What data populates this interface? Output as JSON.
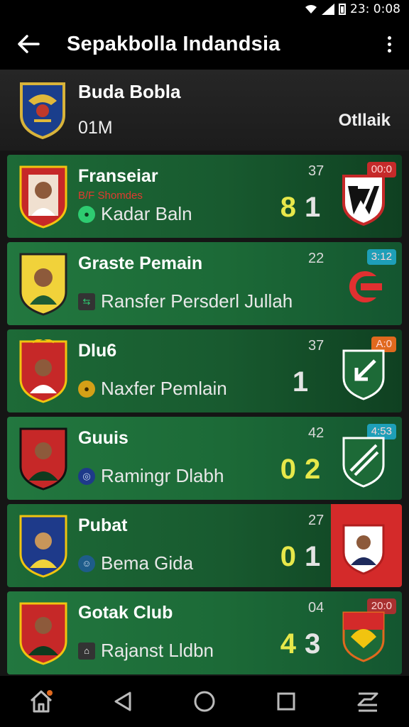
{
  "status": {
    "time": "23: 0:08"
  },
  "appbar": {
    "title": "Sepakbolla Indandsia"
  },
  "header": {
    "club_name": "Buda Bobla",
    "subtitle": "01M",
    "right_label": "Otllaik"
  },
  "matches": [
    {
      "title": "Franseiar",
      "tag": "B/F Shomdes",
      "line": "Kadar Baln",
      "minute": "37",
      "score_home": "8",
      "score_away": "1",
      "badge": "00:0",
      "badge_color": "#c62a2a",
      "icon_color": "#2ecc71"
    },
    {
      "title": "Graste Pemain",
      "tag": "",
      "line": "Ransfer Persderl Jullah",
      "minute": "22",
      "score_home": "",
      "score_away": "",
      "badge": "3:12",
      "badge_color": "#1e9fb8",
      "icon_color": "#7a2a8a"
    },
    {
      "title": "Dlu6",
      "tag": "",
      "line": "Naxfer Pemlain",
      "minute": "37",
      "score_home": "",
      "score_away": "1",
      "badge": "A:0",
      "badge_color": "#e0691e",
      "icon_color": "#d4a017"
    },
    {
      "title": "Guuis",
      "tag": "",
      "line": "Ramingr Dlabh",
      "minute": "42",
      "score_home": "0",
      "score_away": "2",
      "badge": "4:53",
      "badge_color": "#1e9fb8",
      "icon_color": "#1e3a8a"
    },
    {
      "title": "Pubat",
      "tag": "",
      "line": "Bema Gida",
      "minute": "27",
      "score_home": "0",
      "score_away": "1",
      "badge": "",
      "badge_color": "",
      "icon_color": "#1e5c8a"
    },
    {
      "title": "Gotak Club",
      "tag": "",
      "line": "Rajanst Lldbn",
      "minute": "04",
      "score_home": "4",
      "score_away": "3",
      "badge": "20:0",
      "badge_color": "#a83030",
      "icon_color": "#444444"
    }
  ]
}
